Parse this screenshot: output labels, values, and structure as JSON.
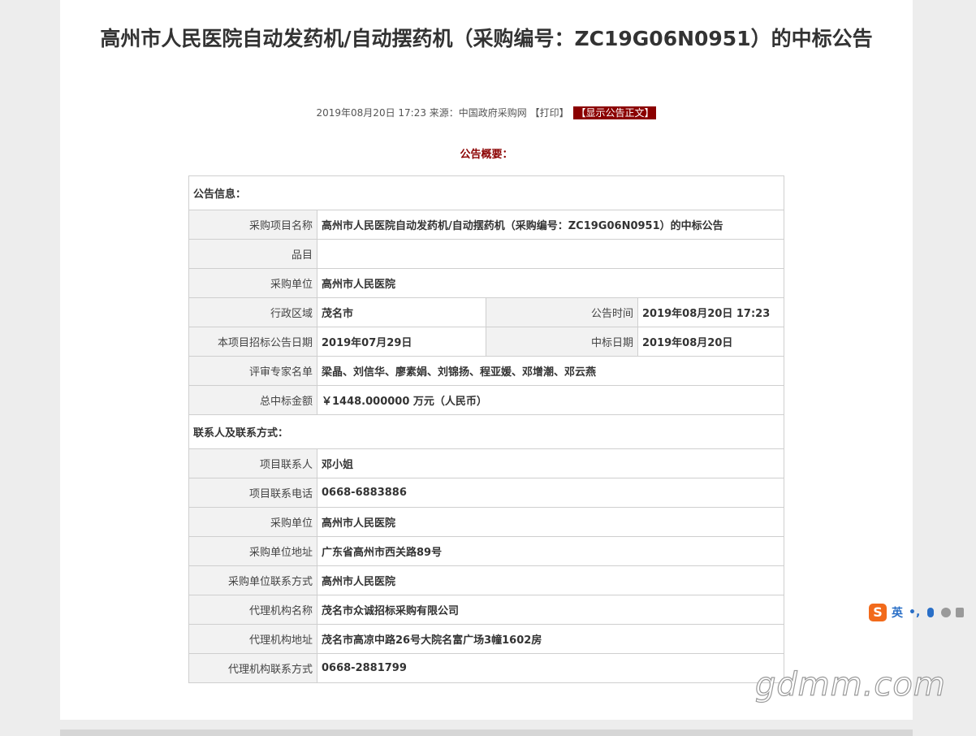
{
  "title": "高州市人民医院自动发药机/自动摆药机（采购编号：ZC19G06N0951）的中标公告",
  "meta": {
    "date_source": "2019年08月20日 17:23 来源：中国政府采购网",
    "print_label": "【打印】",
    "show_label": "【显示公告正文】"
  },
  "summary_label": "公告概要：",
  "sections": {
    "info": "公告信息：",
    "contact": "联系人及联系方式："
  },
  "info": {
    "project_name_label": "采购项目名称",
    "project_name": "高州市人民医院自动发药机/自动摆药机（采购编号：ZC19G06N0951）的中标公告",
    "category_label": "品目",
    "category": "",
    "purchaser_label": "采购单位",
    "purchaser": "高州市人民医院",
    "region_label": "行政区域",
    "region": "茂名市",
    "publish_time_label": "公告时间",
    "publish_time": "2019年08月20日 17:23",
    "tender_date_label": "本项目招标公告日期",
    "tender_date": "2019年07月29日",
    "award_date_label": "中标日期",
    "award_date": "2019年08月20日",
    "experts_label": "评审专家名单",
    "experts": "梁晶、刘信华、廖素娟、刘锦扬、程亚媛、邓增潮、邓云燕",
    "amount_label": "总中标金额",
    "amount": "￥1448.000000 万元（人民币）"
  },
  "contact": {
    "contact_person_label": "项目联系人",
    "contact_person": "邓小姐",
    "contact_phone_label": "项目联系电话",
    "contact_phone": "0668-6883886",
    "purchaser_label": "采购单位",
    "purchaser": "高州市人民医院",
    "purchaser_address_label": "采购单位地址",
    "purchaser_address": "广东省高州市西关路89号",
    "purchaser_contact_label": "采购单位联系方式",
    "purchaser_contact": "高州市人民医院",
    "agency_name_label": "代理机构名称",
    "agency_name": "茂名市众诚招标采购有限公司",
    "agency_address_label": "代理机构地址",
    "agency_address": "茂名市高凉中路26号大院名富广场3幢1602房",
    "agency_contact_label": "代理机构联系方式",
    "agency_contact": "0668-2881799"
  },
  "ime": {
    "logo": "S",
    "lang": "英",
    "punct": "•,"
  },
  "watermark": "gdmm.com"
}
